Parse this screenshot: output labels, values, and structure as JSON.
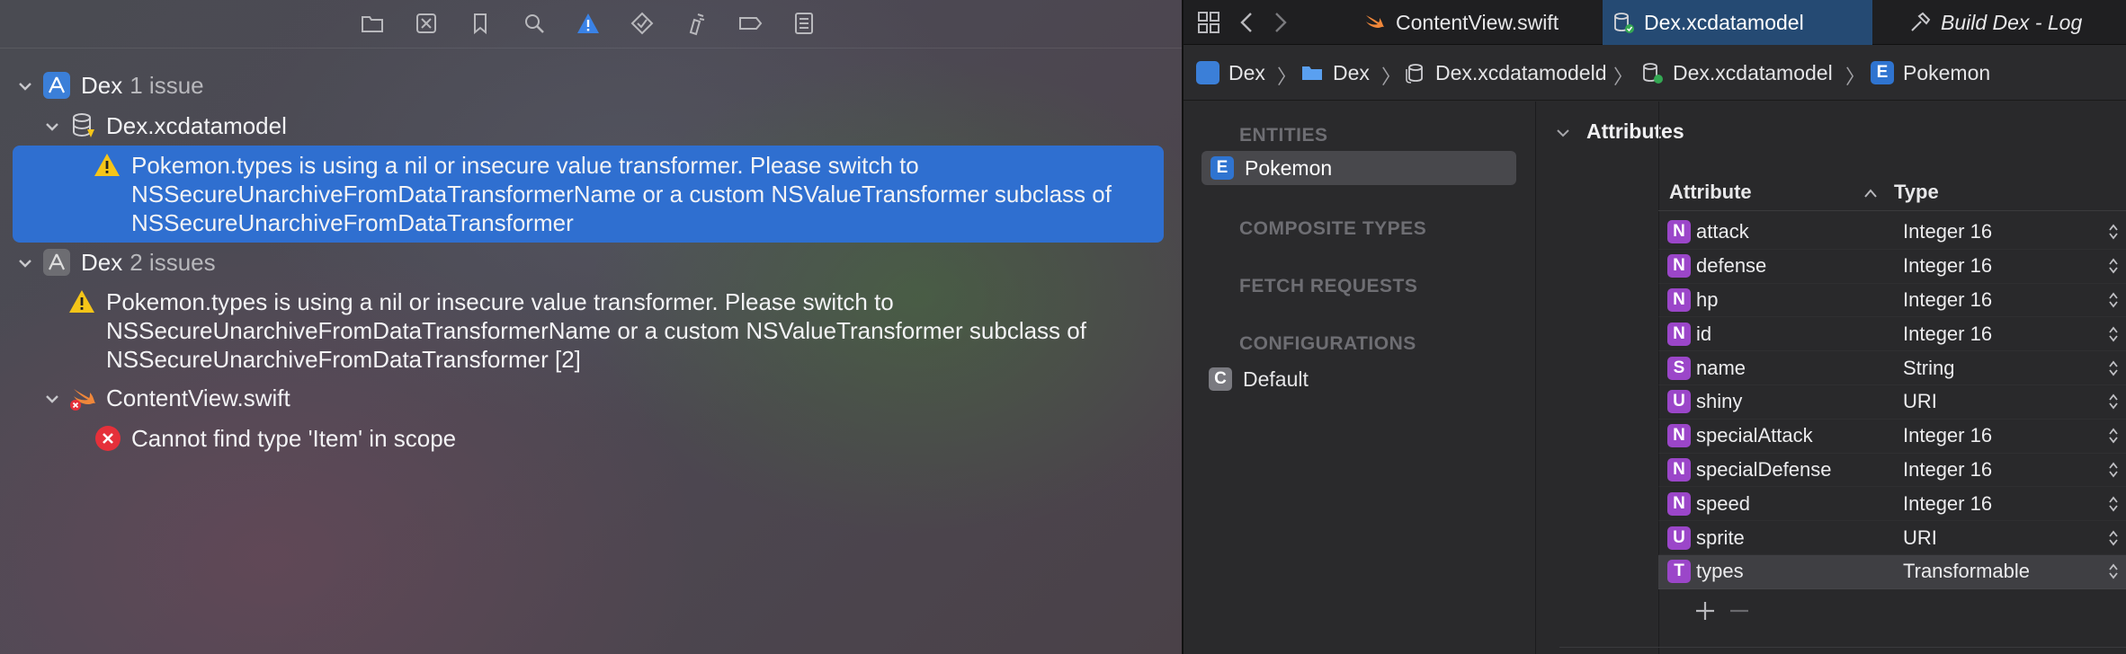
{
  "issue_navigator": {
    "toolbar_icons": [
      "folder-icon",
      "source-control-icon",
      "bookmark-icon",
      "search-icon",
      "warning-icon",
      "test-icon",
      "debug-icon",
      "breakpoint-icon",
      "report-icon"
    ],
    "groups": [
      {
        "title": "Dex",
        "count": "1 issue",
        "file": "Dex.xcdatamodel",
        "issue_lines": [
          "Pokemon.types is using a nil or insecure value transformer. Please switch to",
          "NSSecureUnarchiveFromDataTransformerName or a custom NSValueTransformer subclass of",
          "NSSecureUnarchiveFromDataTransformer"
        ]
      },
      {
        "title": "Dex",
        "count": "2 issues",
        "issue_lines": [
          "Pokemon.types is using a nil or insecure value transformer. Please switch to",
          "NSSecureUnarchiveFromDataTransformerName or a custom NSValueTransformer subclass of",
          "NSSecureUnarchiveFromDataTransformer [2]"
        ],
        "file": "ContentView.swift",
        "error": "Cannot find type 'Item' in scope"
      }
    ]
  },
  "editor_tabs": [
    {
      "label": "ContentView.swift",
      "icon": "swift-icon"
    },
    {
      "label": "Dex.xcdatamodel",
      "icon": "datamodel-icon"
    },
    {
      "label": "Build Dex - Log",
      "icon": "hammer-icon"
    }
  ],
  "jumpbar": [
    "Dex",
    "Dex",
    "Dex.xcdatamodeld",
    "Dex.xcdatamodel",
    "Pokemon"
  ],
  "outline": {
    "entities_label": "ENTITIES",
    "entity": "Pokemon",
    "composite_label": "COMPOSITE TYPES",
    "fetch_label": "FETCH REQUESTS",
    "config_label": "CONFIGURATIONS",
    "config": "Default"
  },
  "attributes": {
    "section_title": "Attributes",
    "col_attribute": "Attribute",
    "col_type": "Type",
    "rows": [
      {
        "badge": "N",
        "name": "attack",
        "type": "Integer 16"
      },
      {
        "badge": "N",
        "name": "defense",
        "type": "Integer 16"
      },
      {
        "badge": "N",
        "name": "hp",
        "type": "Integer 16"
      },
      {
        "badge": "N",
        "name": "id",
        "type": "Integer 16"
      },
      {
        "badge": "S",
        "name": "name",
        "type": "String"
      },
      {
        "badge": "U",
        "name": "shiny",
        "type": "URI"
      },
      {
        "badge": "N",
        "name": "specialAttack",
        "type": "Integer 16"
      },
      {
        "badge": "N",
        "name": "specialDefense",
        "type": "Integer 16"
      },
      {
        "badge": "N",
        "name": "speed",
        "type": "Integer 16"
      },
      {
        "badge": "U",
        "name": "sprite",
        "type": "URI"
      },
      {
        "badge": "T",
        "name": "types",
        "type": "Transformable"
      }
    ]
  },
  "colors": {
    "accent": "#2f6fd0",
    "warning": "#f5c518",
    "error": "#e5303a",
    "attribute_badge": "#9b46c9"
  }
}
